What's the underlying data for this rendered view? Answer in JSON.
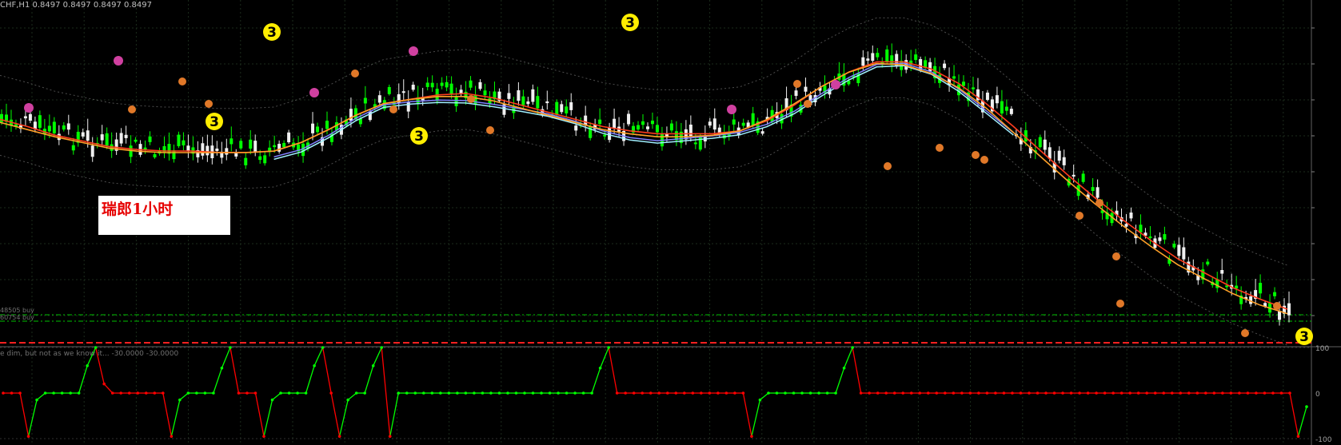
{
  "header": {
    "symbol_line": "CHF,H1  0.8497 0.8497 0.8497 0.8497"
  },
  "indicator": {
    "caption": "e dim, but not as we know it...   -30.0000  -30.0000"
  },
  "label_box": {
    "text": "瑞郎1小时"
  },
  "levels": {
    "buy1": "48505 buy",
    "buy2": "60754 buy"
  },
  "colors": {
    "background": "#000000",
    "grid": "#1c2c1c",
    "bull_candle": "#f0f0f0",
    "bear_candle": "#00ff00",
    "ma_red": "#ff3c1e",
    "ma_orange": "#ffa028",
    "ma_cyan": "#a0f0ff",
    "ma_blue": "#8080ff",
    "band": "#808080",
    "signal_up": "#00ff00",
    "signal_down": "#ff0000",
    "marker_yellow": "#ffee00",
    "marker_magenta": "#d040a0",
    "marker_orange": "#e07828",
    "level_green": "#00c000",
    "level_red": "#ff2020"
  },
  "chart_data": [
    {
      "type": "line",
      "panel": "price",
      "series": [
        {
          "values": [
            0.8597,
            0.8592,
            0.8586,
            0.8582,
            0.8578,
            0.8576,
            0.8575,
            0.8575,
            0.8574,
            0.8574,
            0.8575,
            0.8581,
            0.859,
            0.86,
            0.8608,
            0.8611,
            0.8614,
            0.8615,
            0.8612,
            0.8607,
            0.8602,
            0.8597,
            0.8592,
            0.8589,
            0.8587,
            0.8587,
            0.8587,
            0.8589,
            0.8596,
            0.8607,
            0.862,
            0.863,
            0.8637,
            0.8637,
            0.8632,
            0.8622,
            0.8608,
            0.8592,
            0.8575,
            0.8558,
            0.8542,
            0.8527,
            0.8513,
            0.85,
            0.849,
            0.848,
            0.8472,
            0.8465
          ],
          "colorKey": "ma_red"
        },
        {
          "values": [
            0.8596,
            0.8591,
            0.8586,
            0.8582,
            0.8578,
            0.8576,
            0.8575,
            0.8575,
            0.8575,
            0.8575,
            0.8576,
            0.8582,
            0.8591,
            0.8601,
            0.8609,
            0.8612,
            0.8614,
            0.8614,
            0.8611,
            0.8606,
            0.8601,
            0.8596,
            0.8591,
            0.8588,
            0.8586,
            0.8586,
            0.8587,
            0.859,
            0.8598,
            0.8609,
            0.8621,
            0.8631,
            0.8637,
            0.8636,
            0.863,
            0.862,
            0.8606,
            0.8589,
            0.8572,
            0.8555,
            0.8539,
            0.8524,
            0.851,
            0.8497,
            0.8487,
            0.8477,
            0.8469,
            0.8463
          ],
          "colorKey": "ma_orange"
        }
      ],
      "marker_labels": [
        "3",
        "3",
        "3",
        "3",
        "3"
      ],
      "level_labels": [
        "48505 buy",
        "60754 buy"
      ]
    },
    {
      "type": "line",
      "panel": "oscillator",
      "ylim": [
        -100,
        100
      ],
      "y_ticks": [
        "100",
        "0",
        "-100"
      ],
      "values": [
        0,
        0,
        0,
        -95,
        -15,
        0,
        0,
        0,
        0,
        0,
        60,
        100,
        20,
        0,
        0,
        0,
        0,
        0,
        0,
        0,
        -95,
        -15,
        0,
        0,
        0,
        0,
        55,
        100,
        0,
        0,
        0,
        -95,
        -15,
        0,
        0,
        0,
        0,
        60,
        100,
        0,
        -95,
        -15,
        0,
        0,
        60,
        100,
        -95,
        0,
        0,
        0,
        0,
        0,
        0,
        0,
        0,
        0,
        0,
        0,
        0,
        0,
        0,
        0,
        0,
        0,
        0,
        0,
        0,
        0,
        0,
        0,
        0,
        55,
        100,
        0,
        0,
        0,
        0,
        0,
        0,
        0,
        0,
        0,
        0,
        0,
        0,
        0,
        0,
        0,
        0,
        -95,
        -15,
        0,
        0,
        0,
        0,
        0,
        0,
        0,
        0,
        0,
        55,
        100,
        0,
        0,
        0,
        0,
        0,
        0,
        0,
        0,
        0,
        0,
        0,
        0,
        0,
        0,
        0,
        0,
        0,
        0,
        0,
        0,
        0,
        0,
        0,
        0,
        0,
        0,
        0,
        0,
        0,
        0,
        0,
        0,
        0,
        0,
        0,
        0,
        0,
        0,
        0,
        0,
        0,
        0,
        0,
        0,
        0,
        0,
        0,
        0,
        0,
        0,
        0,
        0,
        -95,
        -30
      ]
    }
  ]
}
